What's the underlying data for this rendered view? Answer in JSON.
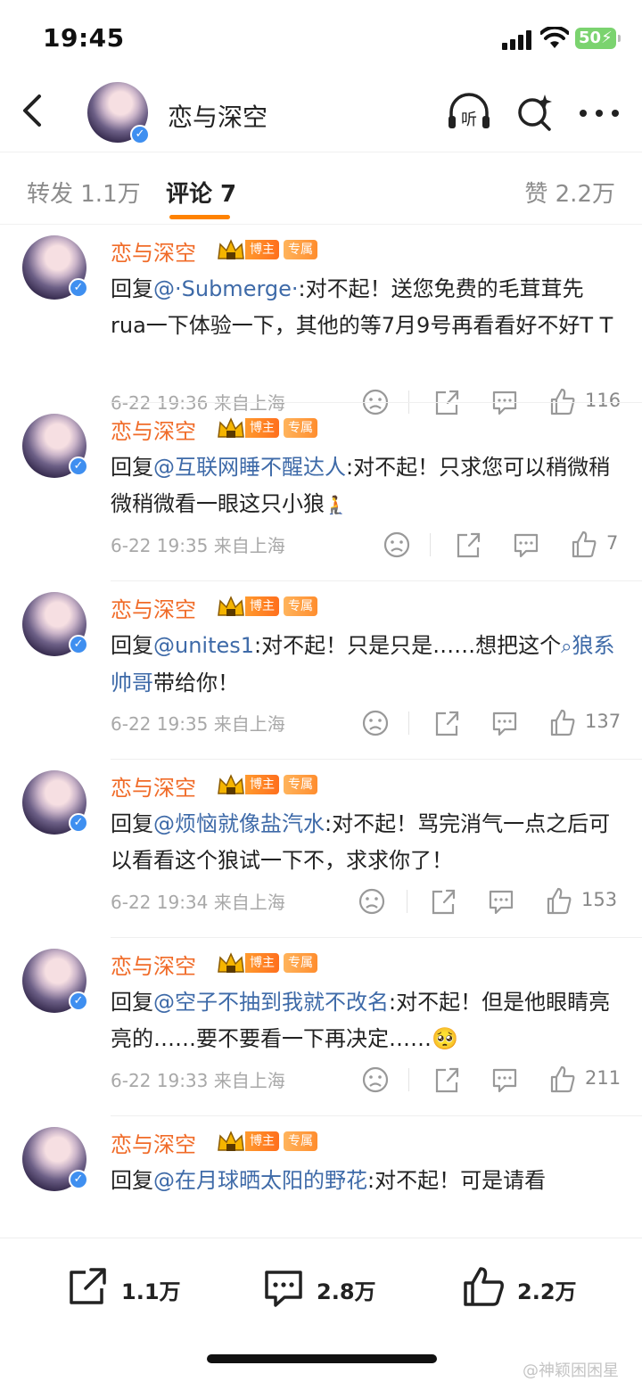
{
  "status_bar": {
    "time": "19:45",
    "battery": "50"
  },
  "header": {
    "title": "恋与深空"
  },
  "tabs": {
    "repost": "转发 1.1万",
    "comment": "评论 7",
    "like": "赞 2.2万"
  },
  "comments": [
    {
      "name": "恋与深空",
      "badge_host": "博主",
      "badge_excl": "专属",
      "reply_prefix": "回复",
      "mention": "@·Submerge·",
      "text": ":对不起！送您免费的毛茸茸先rua一下体验一下，其他的等7月9号再看看好不好T T",
      "time": "6-22 19:36",
      "location": "来自上海",
      "likes": "116"
    },
    {
      "name": "恋与深空",
      "badge_host": "博主",
      "badge_excl": "专属",
      "reply_prefix": "回复",
      "mention": "@互联网睡不醒达人",
      "text": ":对不起！只求您可以稍微稍微稍微看一眼这只小狼",
      "emoji": "🧎",
      "time": "6-22 19:35",
      "location": "来自上海",
      "likes": "7"
    },
    {
      "name": "恋与深空",
      "badge_host": "博主",
      "badge_excl": "专属",
      "reply_prefix": "回复",
      "mention": "@unites1",
      "text": ":对不起！只是只是……想把这个",
      "topic": "狼系帅哥",
      "text_after": "带给你！",
      "time": "6-22 19:35",
      "location": "来自上海",
      "likes": "137"
    },
    {
      "name": "恋与深空",
      "badge_host": "博主",
      "badge_excl": "专属",
      "reply_prefix": "回复",
      "mention": "@烦恼就像盐汽水",
      "text": ":对不起！骂完消气一点之后可以看看这个狼试一下不，求求你了！",
      "time": "6-22 19:34",
      "location": "来自上海",
      "likes": "153"
    },
    {
      "name": "恋与深空",
      "badge_host": "博主",
      "badge_excl": "专属",
      "reply_prefix": "回复",
      "mention": "@空子不抽到我就不改名",
      "text": ":对不起！但是他眼睛亮亮的……要不要看一下再决定……",
      "emoji": "🥺",
      "time": "6-22 19:33",
      "location": "来自上海",
      "likes": "211"
    },
    {
      "name": "恋与深空",
      "badge_host": "博主",
      "badge_excl": "专属",
      "reply_prefix": "回复",
      "mention": "@在月球晒太阳的野花",
      "text": ":对不起！可是请看"
    }
  ],
  "bottom_bar": {
    "repost": "1.1万",
    "comment": "2.8万",
    "like": "2.2万"
  },
  "watermark": "@神颖困困星",
  "colors": {
    "accent": "#ff8200",
    "name": "#f06b28",
    "link": "#3e6aa8"
  }
}
